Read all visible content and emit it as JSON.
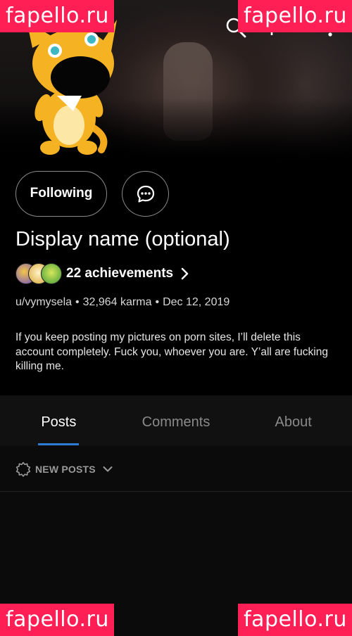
{
  "watermark": "fapello.ru",
  "profile": {
    "follow_label": "Following",
    "display_name": "Display name (optional)",
    "achievements_label": "22 achievements",
    "username": "u/vymysela",
    "karma": "32,964 karma",
    "cake_day": "Dec 12, 2019",
    "separator": "•",
    "bio": "If you keep posting my pictures on porn sites, I’ll delete this account completely. Fuck you, whoever you are. Y’all are fucking killing me."
  },
  "tabs": [
    {
      "label": "Posts",
      "active": true
    },
    {
      "label": "Comments",
      "active": false
    },
    {
      "label": "About",
      "active": false
    }
  ],
  "sort": {
    "label": "NEW POSTS",
    "icon": "new-burst-icon"
  },
  "icons": {
    "search": "search-icon",
    "share": "share-icon",
    "more": "more-icon",
    "chat": "chat-bubble-icon",
    "chevron": "chevron-right-icon",
    "dropdown": "chevron-down-icon"
  },
  "colors": {
    "accent": "#2e7bd6",
    "watermark_bg": "#ff1f55",
    "background": "#000000",
    "tab_bar": "#111111"
  }
}
